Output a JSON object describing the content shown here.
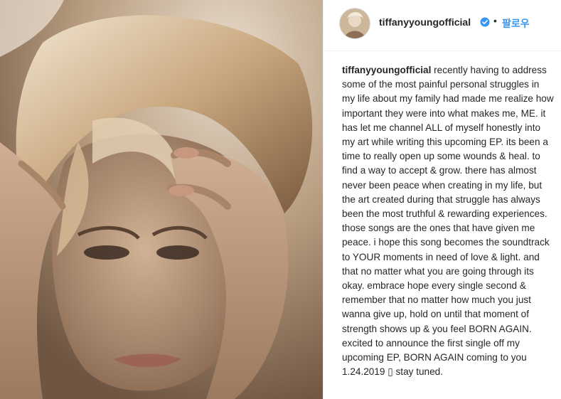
{
  "post": {
    "username": "tiffanyyoungofficial",
    "follow_label": "팔로우",
    "separator": "•",
    "caption": {
      "username": "tiffanyyoungofficial",
      "text": "recently having to address some of the most painful personal struggles in my life about my family had made me realize how important they were into what makes me, ME. it has let me channel ALL of myself honestly into my art while writing this upcoming EP. its been a time to really open up some wounds & heal. to find a way to accept & grow. there has almost never been peace when creating in my life, but the art created during that struggle has always been the most truthful & rewarding experiences. those songs are the ones that have given me peace. i hope this song becomes the soundtrack to YOUR moments in need of love & light. and that no matter what you are going through its okay. embrace hope every single second & remember that no matter how much you just wanna give up, hold on until that moment of strength shows up & you feel BORN AGAIN. excited to announce the first single off my upcoming EP, BORN AGAIN coming to you 1.24.2019 ▯ stay tuned."
    }
  },
  "icons": {
    "verified": "verified-badge-icon",
    "avatar": "profile-avatar"
  },
  "colors": {
    "link_blue": "#3897f0",
    "text": "#262626",
    "border": "#efefef"
  }
}
